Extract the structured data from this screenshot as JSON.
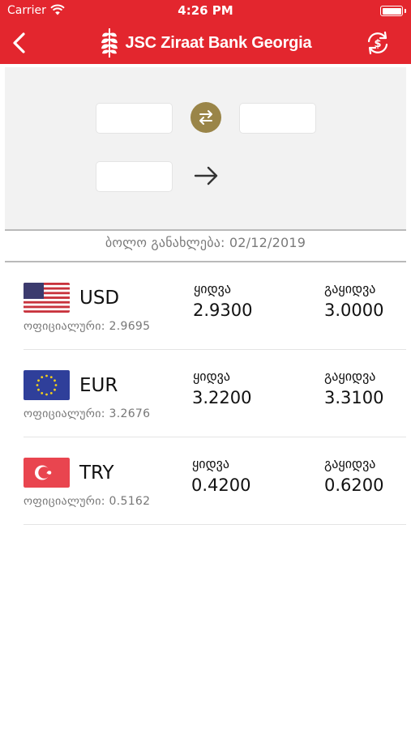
{
  "status_bar": {
    "carrier": "Carrier",
    "time": "4:26 PM"
  },
  "nav": {
    "title": "JSC Ziraat Bank Georgia"
  },
  "converter": {
    "from_value": "",
    "to_value": "",
    "amount_value": ""
  },
  "last_update": "ბოლო განახლება: 02/12/2019",
  "rates": [
    {
      "code": "USD",
      "official": "ოფიციალური: 2.9695",
      "buy_label": "ყიდვა",
      "buy": "2.9300",
      "sell_label": "გაყიდვა",
      "sell": "3.0000"
    },
    {
      "code": "EUR",
      "official": "ოფიციალური: 3.2676",
      "buy_label": "ყიდვა",
      "buy": "3.2200",
      "sell_label": "გაყიდვა",
      "sell": "3.3100"
    },
    {
      "code": "TRY",
      "official": "ოფიციალური: 0.5162",
      "buy_label": "ყიდვა",
      "buy": "0.4200",
      "sell_label": "გაყიდვა",
      "sell": "0.6200"
    }
  ],
  "colors": {
    "brand_red": "#e3262e",
    "swap_gold": "#9a8548",
    "panel_gray": "#f2f2f2"
  },
  "icons": {
    "back": "chevron-left-icon",
    "logo": "wheat-logo-icon",
    "exchange": "currency-exchange-icon",
    "swap": "swap-arrows-icon",
    "convert_arrow": "arrow-right-icon"
  }
}
